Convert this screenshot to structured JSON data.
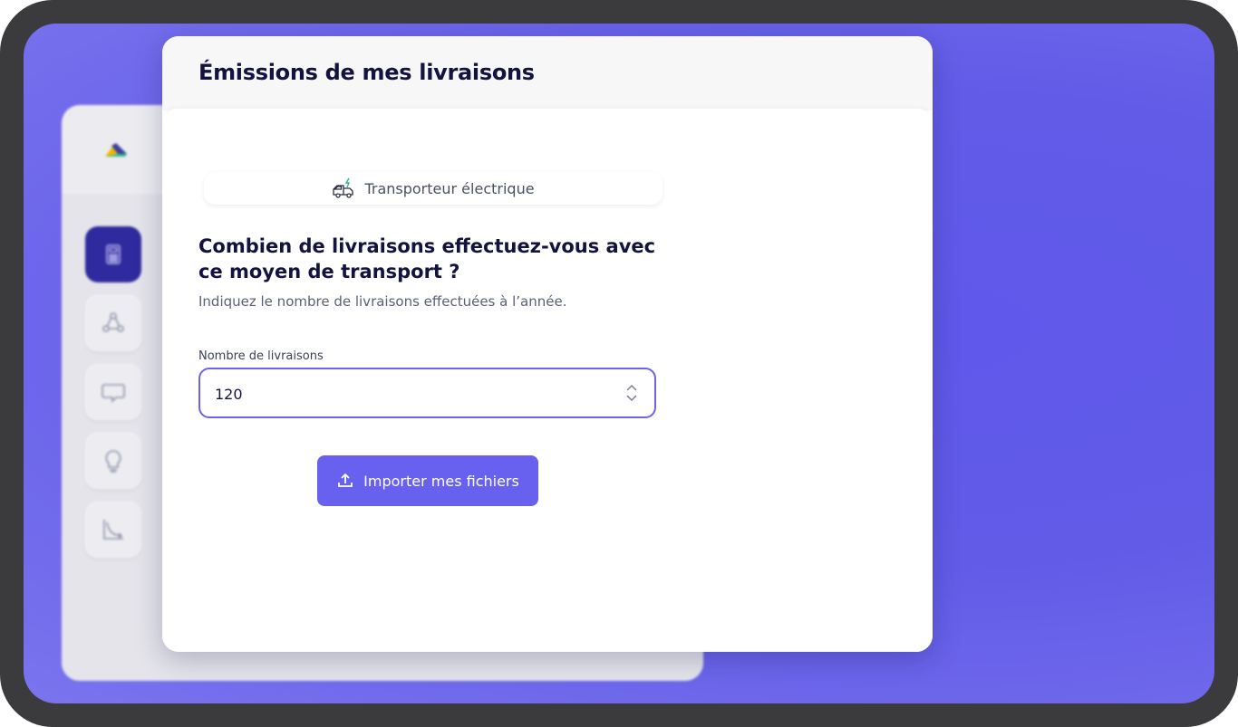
{
  "card": {
    "title": "Émissions de mes livraisons"
  },
  "transport": {
    "label": "Transporteur électrique",
    "icon": "electric-truck-icon"
  },
  "question": {
    "title": "Combien de livraisons effectuez-vous avec ce moyen de transport ?",
    "hint": "Indiquez le nombre de livraisons effectuées à l’année."
  },
  "field": {
    "label": "Nombre de livraisons",
    "value": "120"
  },
  "import_button": {
    "label": "Importer mes fichiers",
    "icon": "upload-icon"
  },
  "sidebar": {
    "items": [
      {
        "icon": "calculator-icon",
        "active": true
      },
      {
        "icon": "share-nodes-icon",
        "active": false
      },
      {
        "icon": "chat-bubble-icon",
        "active": false
      },
      {
        "icon": "lightbulb-icon",
        "active": false
      },
      {
        "icon": "chart-curve-icon",
        "active": false
      }
    ]
  },
  "colors": {
    "accent": "#6860ef",
    "background": "#625be8",
    "active_nav": "#2f2b9e",
    "title": "#14123f"
  }
}
